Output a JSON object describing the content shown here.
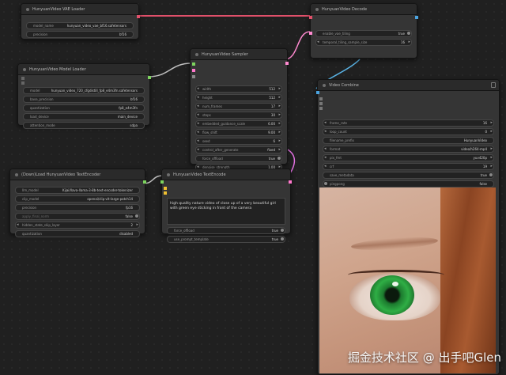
{
  "nodes": {
    "vae_loader": {
      "title": "HunyuanVideo VAE Loader",
      "widgets": [
        {
          "label": "model_name",
          "value": "hunyuan_video_vae_bf16.safetensors"
        },
        {
          "label": "precision",
          "value": "bf16"
        }
      ]
    },
    "decode": {
      "title": "HunyuanVideo Decode",
      "widgets": [
        {
          "label": "enable_vae_tiling",
          "value": "true"
        },
        {
          "label": "temporal_tiling_sample_size",
          "value": "16"
        }
      ]
    },
    "model_loader": {
      "title": "HunyuanVideo Model Loader",
      "widgets": [
        {
          "label": "model",
          "value": "hunyuan_video_720_cfgdistill_fp8_e4m3fn.safetensors"
        },
        {
          "label": "base_precision",
          "value": "bf16"
        },
        {
          "label": "quantization",
          "value": "fp8_e4m3fn"
        },
        {
          "label": "load_device",
          "value": "main_device"
        },
        {
          "label": "attention_mode",
          "value": "sdpa"
        }
      ]
    },
    "sampler": {
      "title": "HunyuanVideo Sampler",
      "widgets": [
        {
          "label": "width",
          "value": "512"
        },
        {
          "label": "height",
          "value": "512"
        },
        {
          "label": "num_frames",
          "value": "17"
        },
        {
          "label": "steps",
          "value": "30"
        },
        {
          "label": "embedded_guidance_scale",
          "value": "6.00"
        },
        {
          "label": "flow_shift",
          "value": "9.00"
        },
        {
          "label": "seed",
          "value": "6"
        },
        {
          "label": "control_after_generate",
          "value": "fixed"
        },
        {
          "label": "force_offload",
          "value": "true"
        },
        {
          "label": "denoise_strength",
          "value": "1.00"
        }
      ]
    },
    "combine": {
      "title": "Video Combine",
      "widgets": [
        {
          "label": "frame_rate",
          "value": "16"
        },
        {
          "label": "loop_count",
          "value": "0"
        },
        {
          "label": "filename_prefix",
          "value": "HunyuanVideo"
        },
        {
          "label": "format",
          "value": "video/h264-mp4"
        },
        {
          "label": "pix_fmt",
          "value": "yuv420p"
        },
        {
          "label": "crf",
          "value": "19"
        },
        {
          "label": "save_metadata",
          "value": "true"
        },
        {
          "label": "pingpong",
          "value": "false"
        },
        {
          "label": "save_output",
          "value": "true"
        }
      ]
    },
    "text_encoder_loader": {
      "title": "(Down)Load HunyuanVideo TextEncoder",
      "widgets": [
        {
          "label": "llm_model",
          "value": "Kijai/llava-llama-3-8b-text-encoder-tokenizer"
        },
        {
          "label": "clip_model",
          "value": "openai/clip-vit-large-patch14"
        },
        {
          "label": "precision",
          "value": "fp16"
        },
        {
          "label": "apply_final_norm",
          "value": "false"
        },
        {
          "label": "hidden_state_skip_layer",
          "value": "2"
        },
        {
          "label": "quantization",
          "value": "disabled"
        }
      ]
    },
    "text_encode": {
      "title": "HunyuanVideo TextEncode",
      "prompt": "high quality nature video of close up of a very beautiful girl with green eye sticking in front of the camera",
      "widgets": [
        {
          "label": "force_offload",
          "value": "true"
        },
        {
          "label": "use_prompt_template",
          "value": "true"
        }
      ]
    }
  },
  "watermark": "掘金技术社区 @ 出手吧Glen",
  "colors": {
    "link_vae": "#e0506a",
    "link_model": "#c0c0c0",
    "link_text": "#e070e0",
    "link_latent": "#ff8ad0",
    "link_images": "#5ab4e6",
    "socket_green": "#7dd35e",
    "socket_pink": "#ff77cc",
    "socket_yellow": "#f0c030",
    "socket_blue": "#4aa3df"
  }
}
